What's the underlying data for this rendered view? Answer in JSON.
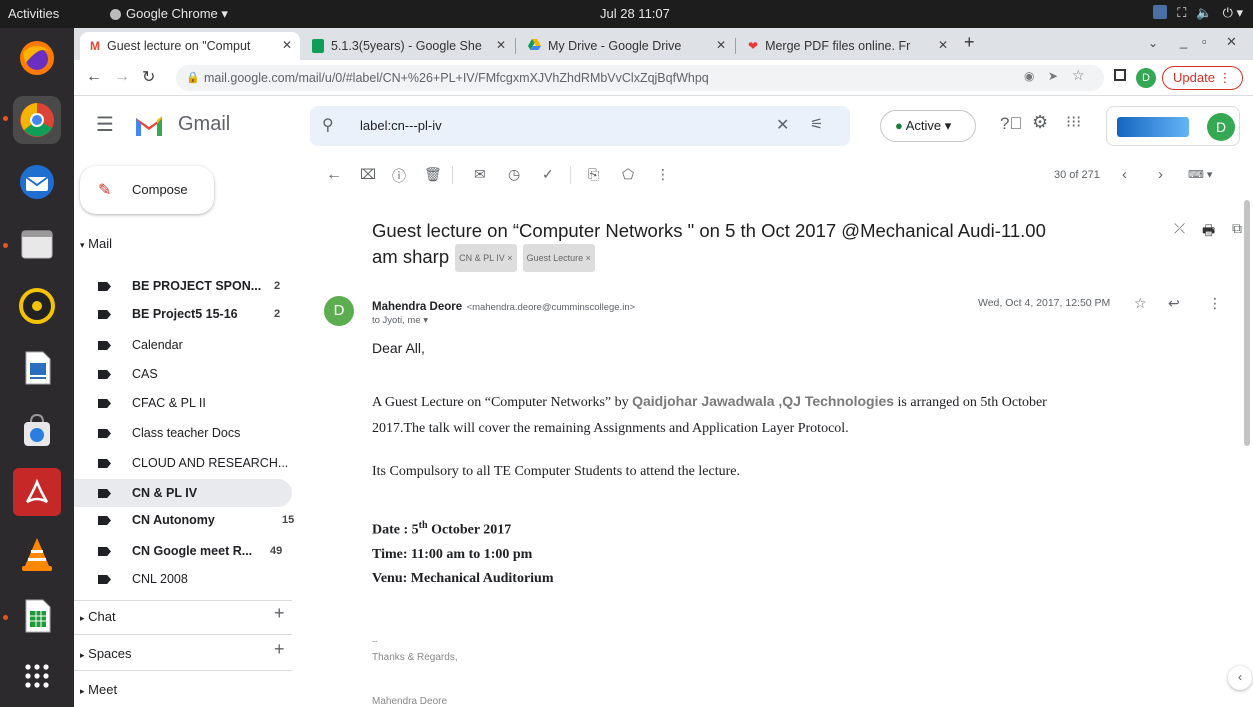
{
  "system": {
    "activities": "Activities",
    "app_name": "Google Chrome ▾",
    "clock": "Jul 28  11:07"
  },
  "browser": {
    "tabs": [
      {
        "label": "Guest lecture on \"Comput"
      },
      {
        "label": "5.1.3(5years) - Google She"
      },
      {
        "label": "My Drive - Google Drive"
      },
      {
        "label": "Merge PDF files online. Fr"
      }
    ],
    "new_tab": "+",
    "url": "mail.google.com/mail/u/0/#label/CN+%26+PL+IV/FMfcgxmXJVhZhdRMbVvClxZqjBqfWhpq",
    "update_label": "Update",
    "profile_initial": "D"
  },
  "gmail": {
    "brand": "Gmail",
    "search_value": "label:cn---pl-iv",
    "status": "Active",
    "avatar_initial": "D",
    "compose": "Compose",
    "mail_header": "Mail",
    "labels": [
      {
        "name": "BE PROJECT SPON...",
        "count": "2",
        "bold": true
      },
      {
        "name": "BE Project5 15-16",
        "count": "2",
        "bold": true
      },
      {
        "name": "Calendar",
        "count": ""
      },
      {
        "name": "CAS",
        "count": ""
      },
      {
        "name": "CFAC & PL II",
        "count": ""
      },
      {
        "name": "Class teacher Docs",
        "count": ""
      },
      {
        "name": "CLOUD AND RESEARCH...",
        "count": ""
      },
      {
        "name": "CN & PL IV",
        "count": "",
        "bold": true,
        "selected": true
      },
      {
        "name": "CN Autonomy",
        "count": "15",
        "bold": true
      },
      {
        "name": "CN Google meet R...",
        "count": "49",
        "bold": true
      },
      {
        "name": "CNL 2008",
        "count": ""
      }
    ],
    "sections": {
      "chat": "Chat",
      "spaces": "Spaces",
      "meet": "Meet"
    },
    "pagination": "30 of 271",
    "email": {
      "subject_line1": "Guest lecture on “Computer Networks \" on 5 th Oct 2017 @Mechanical Audi-11.00",
      "subject_line2": "am sharp",
      "chip1": "CN & PL IV ×",
      "chip2": "Guest Lecture ×",
      "sender_initial": "D",
      "sender_name": "Mahendra Deore",
      "sender_email": "<mahendra.deore@cumminscollege.in>",
      "recipients": "to Jyoti, me ▾",
      "date": "Wed, Oct 4, 2017, 12:50 PM",
      "greeting": "Dear All,",
      "p1_a": "A Guest Lecture on “Computer Networks” by ",
      "p1_name": "Qaidjohar Jawadwala ,QJ Technologies",
      "p1_b": " is arranged on 5th October",
      "p1_line2": "2017.The talk will cover the remaining Assignments and Application Layer Protocol.",
      "p2": "Its Compulsory to all TE Computer Students to attend the lecture.",
      "date_label": "Date : 5",
      "date_sup": "th",
      "date_rest": " October 2017",
      "time": "Time: 11:00 am to 1:00 pm",
      "venue": "Venu: Mechanical Auditorium",
      "sig_dash": "--",
      "sig_thanks": "Thanks & Regards,",
      "sig_name": "Mahendra Deore"
    }
  },
  "colors": {
    "gmail_red": "#ea4335",
    "avatar_green": "#34a853",
    "selected_label": "#e8eaed",
    "link_gray": "#7a7a7a"
  }
}
